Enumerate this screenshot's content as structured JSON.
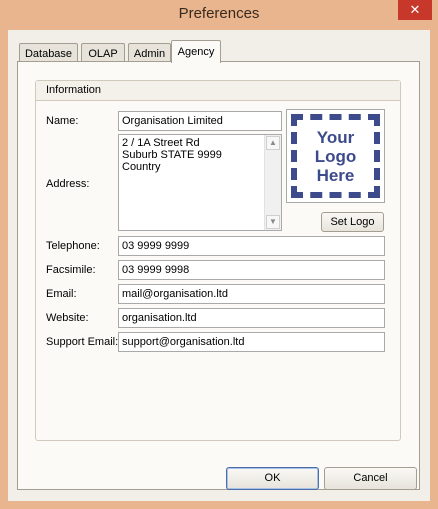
{
  "window": {
    "title": "Preferences",
    "close_glyph": "✕"
  },
  "tabs": [
    {
      "label": "Database"
    },
    {
      "label": "OLAP"
    },
    {
      "label": "Admin"
    },
    {
      "label": "Agency",
      "active": true
    }
  ],
  "information": {
    "group_title": "Information",
    "name": {
      "label": "Name:",
      "value": "Organisation Limited"
    },
    "address": {
      "label": "Address:",
      "lines": [
        "2 / 1A Street Rd",
        "Suburb STATE 9999",
        "Country"
      ]
    },
    "logo": {
      "lines": [
        "Your",
        "Logo",
        "Here"
      ],
      "button_label": "Set Logo"
    },
    "telephone": {
      "label": "Telephone:",
      "value": "03 9999 9999"
    },
    "facsimile": {
      "label": "Facsimile:",
      "value": "03 9999 9998"
    },
    "email": {
      "label": "Email:",
      "value": "mail@organisation.ltd"
    },
    "website": {
      "label": "Website:",
      "value": "organisation.ltd"
    },
    "support_email": {
      "label": "Support Email:",
      "value": "support@organisation.ltd"
    }
  },
  "buttons": {
    "ok": "OK",
    "cancel": "Cancel"
  },
  "colors": {
    "frame": "#e9b58e",
    "close": "#c7382b",
    "logo": "#3d4b8c",
    "client": "#f2efe8"
  },
  "icons": {
    "close": "close-icon",
    "scroll_up": "chevron-up-icon",
    "scroll_down": "chevron-down-icon"
  }
}
